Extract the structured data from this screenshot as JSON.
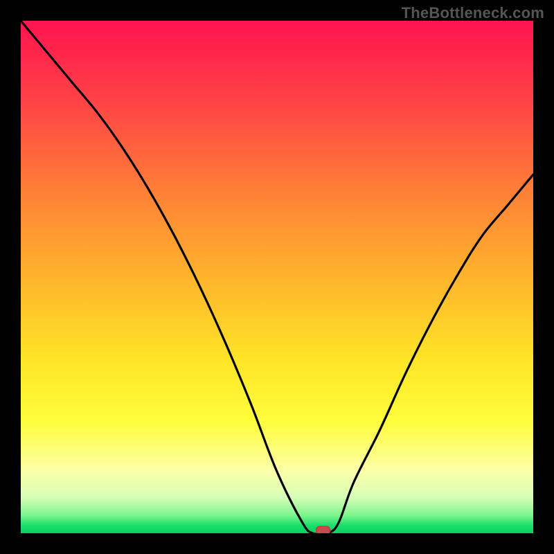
{
  "watermark": "TheBottleneck.com",
  "colors": {
    "background": "#000000",
    "curve": "#000000",
    "marker": "#c94a4c",
    "gradient_top": "#ff1450",
    "gradient_bottom": "#0bd05e"
  },
  "chart_data": {
    "type": "line",
    "title": "",
    "xlabel": "",
    "ylabel": "",
    "xlim": [
      0,
      100
    ],
    "ylim": [
      0,
      100
    ],
    "grid": false,
    "legend": false,
    "background": "red-yellow-green vertical gradient",
    "series": [
      {
        "name": "bottleneck-curve",
        "x": [
          0,
          5,
          10,
          15,
          20,
          25,
          30,
          35,
          40,
          45,
          50,
          55,
          57,
          59,
          60,
          62,
          65,
          70,
          75,
          80,
          85,
          90,
          95,
          100
        ],
        "values": [
          100,
          94,
          88,
          82,
          75,
          67,
          58,
          48,
          37,
          25,
          12,
          2,
          0,
          0,
          0,
          2,
          10,
          20,
          31,
          41,
          50,
          58,
          64,
          70
        ]
      }
    ],
    "marker": {
      "x": 59,
      "y": 0
    }
  }
}
